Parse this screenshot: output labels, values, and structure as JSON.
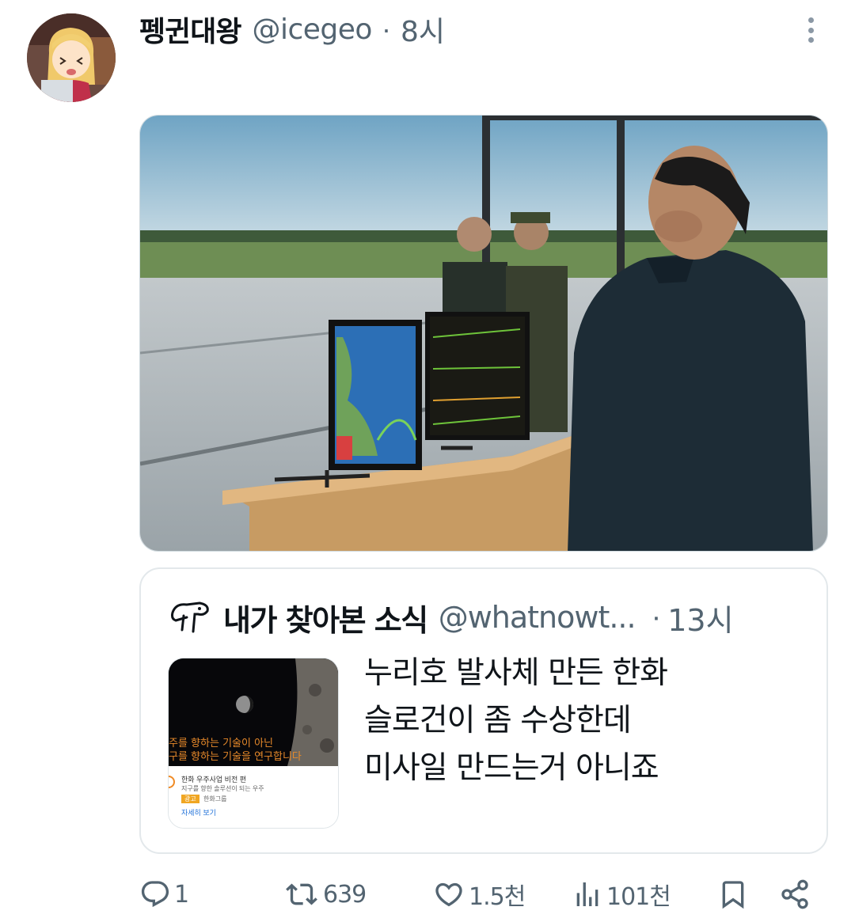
{
  "post": {
    "author_name": "펭귄대왕",
    "author_handle": "@icegeo",
    "separator": "·",
    "time": "8시"
  },
  "quote": {
    "author_name": "내가 찾아본 소식",
    "author_handle": "@whatnowt...",
    "separator": "·",
    "time": "13시",
    "text_lines": [
      "누리호 발사체 만든 한화",
      "슬로건이 좀 수상한데",
      "미사일 만드는거 아니죠"
    ],
    "thumbnail": {
      "line1": "주를 향하는 기술이 아닌",
      "line2": "구를 향하는 기술을 연구합니다",
      "ad_title": "한화 우주사업 비전 편",
      "ad_desc": "지구를 향한 솔루션이 되는 우주",
      "ad_badge": "광고",
      "ad_brand": "한화그룹",
      "ad_link": "자세히 보기"
    }
  },
  "actions": {
    "replies": "1",
    "reposts": "639",
    "likes": "1.5천",
    "views": "101천"
  },
  "icons": {
    "more": "more-vertical-icon",
    "reply": "reply-icon",
    "repost": "repost-icon",
    "like": "heart-icon",
    "views": "views-chart-icon",
    "bookmark": "bookmark-icon",
    "share": "share-icon"
  },
  "colors": {
    "text_primary": "#0f1419",
    "text_secondary": "#536471",
    "border": "#e3e8eb"
  }
}
